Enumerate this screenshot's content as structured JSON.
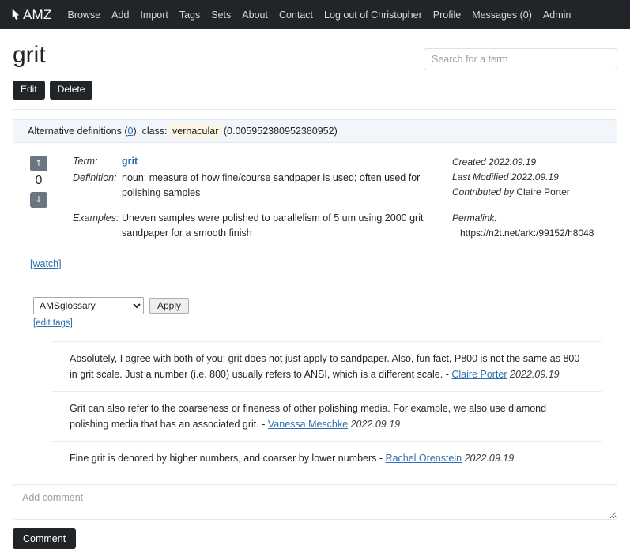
{
  "navbar": {
    "brand": "AMZ",
    "brand_icon": "cursor-pointer-icon",
    "items": [
      {
        "label": "Browse"
      },
      {
        "label": "Add"
      },
      {
        "label": "Import"
      },
      {
        "label": "Tags"
      },
      {
        "label": "Sets"
      },
      {
        "label": "About"
      },
      {
        "label": "Contact"
      },
      {
        "label": "Log out of Christopher"
      },
      {
        "label": "Profile"
      },
      {
        "label": "Messages (0)"
      },
      {
        "label": "Admin"
      }
    ],
    "bg_color": "#212529"
  },
  "header": {
    "title": "grit",
    "search_placeholder": "Search for a term",
    "search_value": "",
    "edit_label": "Edit",
    "delete_label": "Delete"
  },
  "alt_definitions": {
    "prefix": "Alternative definitions",
    "count": "(0)",
    "count_link": "0",
    "class_label": "class:",
    "class_value": "vernacular",
    "class_score": "(0.005952380952380952)",
    "highlight_color": "#fdf6dd",
    "bg_color": "#f2f5f9"
  },
  "vote": {
    "up_icon": "arrow-up-icon",
    "down_icon": "arrow-down-icon",
    "score": "0"
  },
  "definition": {
    "term_label": "Term:",
    "term_value": "grit",
    "definition_label": "Definition:",
    "definition_value": "noun: measure of how fine/course sandpaper is used; often used for polishing samples",
    "examples_label": "Examples:",
    "examples_value": "Uneven samples were polished to parallelism of 5 um using 2000 grit sandpaper for a smooth finish"
  },
  "meta": {
    "created_label": "Created",
    "created_value": "2022.09.19",
    "modified_label": "Last Modified",
    "modified_value": "2022.09.19",
    "contributed_label": "Contributed by",
    "contributed_value": "Claire Porter",
    "permalink_label": "Permalink:",
    "permalink_url": "https://n2t.net/ark:/99152/h8048"
  },
  "watch": {
    "label": "[watch]"
  },
  "tags": {
    "selected": "AMSglossary",
    "options": [
      "AMSglossary"
    ],
    "apply_label": "Apply",
    "edit_label": "[edit tags]"
  },
  "comments": {
    "items": [
      {
        "body": "Absolutely, I agree with both of you; grit does not just apply to sandpaper. Also, fun fact, P800 is not the same as 800 in grit scale. Just a number (i.e. 800) usually refers to ANSI, which is a different scale.",
        "separator": "-",
        "author": "Claire Porter",
        "date": "2022.09.19"
      },
      {
        "body": "Grit can also refer to the coarseness or fineness of other polishing media. For example, we also use diamond polishing media that has an associated grit.",
        "separator": "-",
        "author": "Vanessa Meschke",
        "date": "2022.09.19"
      },
      {
        "body": "Fine grit is denoted by higher numbers, and coarser by lower numbers",
        "separator": "-",
        "author": "Rachel Orenstein",
        "date": "2022.09.19"
      }
    ]
  },
  "add_comment": {
    "placeholder": "Add comment",
    "value": "",
    "submit_label": "Comment"
  },
  "colors": {
    "link": "#2f6fb0",
    "dark": "#212529",
    "vote_button": "#6c7682"
  }
}
